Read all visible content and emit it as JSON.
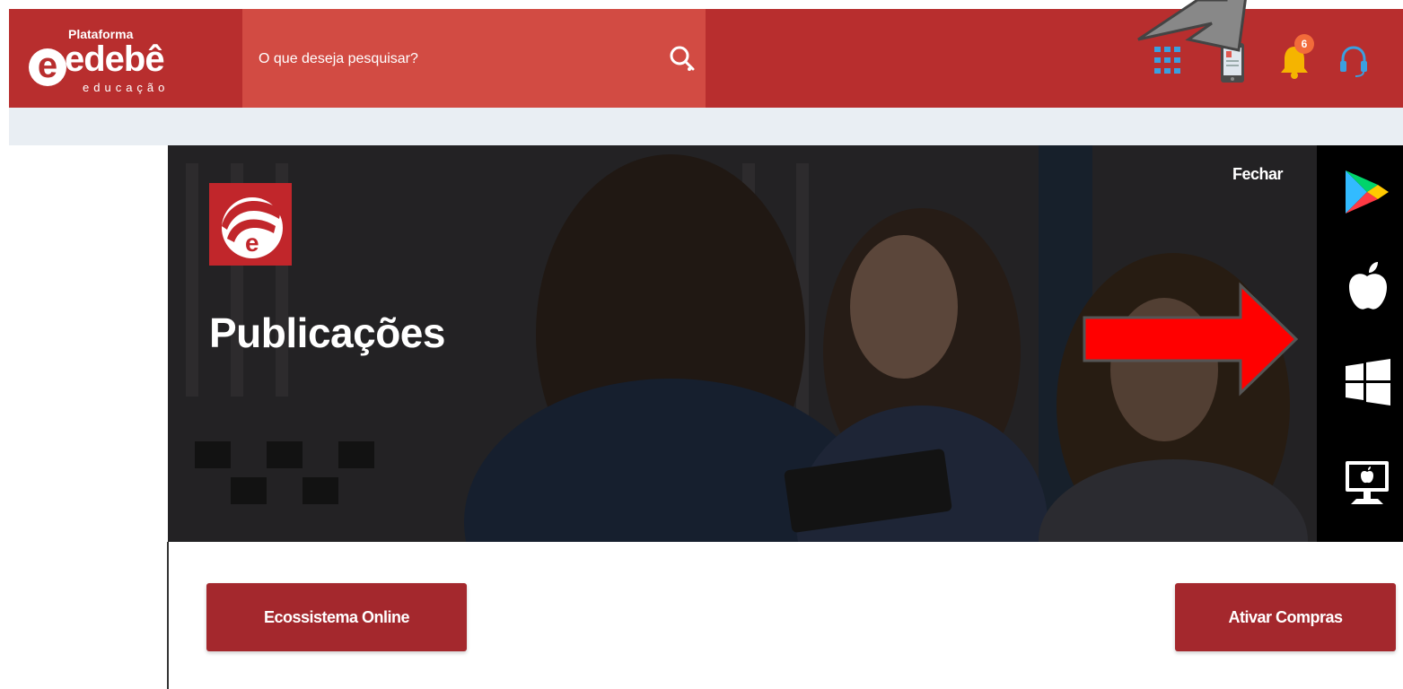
{
  "colors": {
    "header_bg": "#b82e2e",
    "search_bg": "#d24b43",
    "subbar_bg": "#e9eef3",
    "button_bg": "#a4282d",
    "badge_bg": "#f26b3a",
    "grid_icon": "#3aa0e0",
    "bell_icon": "#f5b400",
    "annotation_red": "#ff0000",
    "annotation_gray": "#888888"
  },
  "header": {
    "logo": {
      "top_text": "Plataforma",
      "brand": "edebê",
      "sub": "educação"
    },
    "search": {
      "placeholder": "O que deseja pesquisar?",
      "icon": "search-icon"
    },
    "icons": [
      "apps-grid-icon",
      "tablet-icon",
      "bell-icon",
      "headset-icon"
    ],
    "notification_count": "6"
  },
  "banner": {
    "title": "Publicações",
    "close_label": "Fechar"
  },
  "stores": [
    "google-play-icon",
    "apple-icon",
    "windows-icon",
    "mac-desktop-icon"
  ],
  "actions": {
    "ecosystem_label": "Ecossistema Online",
    "activate_label": "Ativar Compras"
  }
}
